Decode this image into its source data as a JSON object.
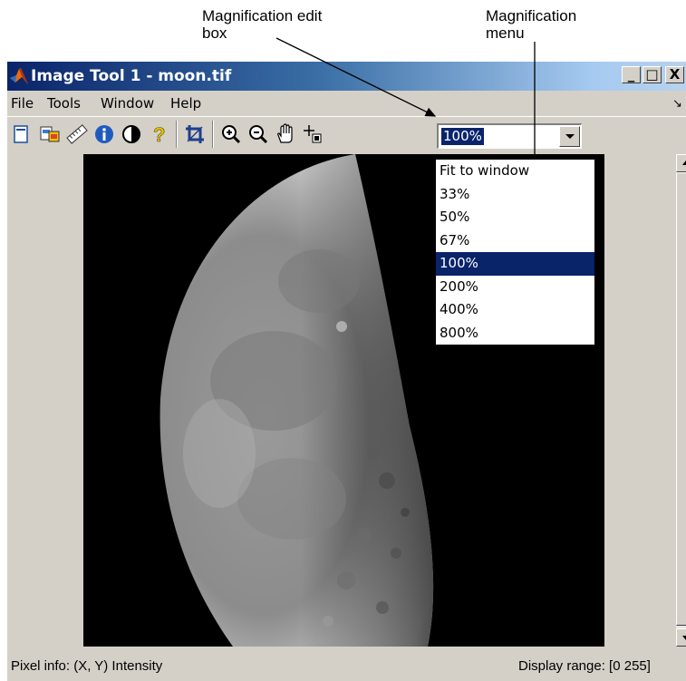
{
  "annotations": {
    "edit_box": {
      "line1": "Magnification edit",
      "line2": "box"
    },
    "menu": {
      "line1": "Magnification",
      "line2": "menu"
    }
  },
  "window": {
    "title": "Image Tool 1 - moon.tif",
    "controls": {
      "minimize": "_",
      "maximize": "□",
      "close": "X"
    }
  },
  "menubar": {
    "items": [
      "File",
      "Tools",
      "Window",
      "Help"
    ],
    "dock_arrow": "↘"
  },
  "toolbar": {
    "buttons": [
      "new-figure-icon",
      "export-icon",
      "measure-distance-icon",
      "image-info-icon",
      "adjust-contrast-icon",
      "help-icon",
      "crop-icon",
      "zoom-in-icon",
      "zoom-out-icon",
      "pan-hand-icon",
      "pixel-region-icon"
    ],
    "magnification": {
      "value": "100%"
    }
  },
  "magnification_menu": {
    "options": [
      "Fit to window",
      "33%",
      "50%",
      "67%",
      "100%",
      "200%",
      "400%",
      "800%"
    ],
    "selected": "100%"
  },
  "image": {
    "file": "moon.tif"
  },
  "statusbar": {
    "pixel_info": "Pixel info: (X, Y)  Intensity",
    "display_range": "Display range: [0 255]"
  },
  "colors": {
    "title_start": "#0a246a",
    "title_end": "#a6caf0",
    "chrome": "#d4d0c8",
    "selection": "#0a246a",
    "image_bg": "#000000"
  }
}
